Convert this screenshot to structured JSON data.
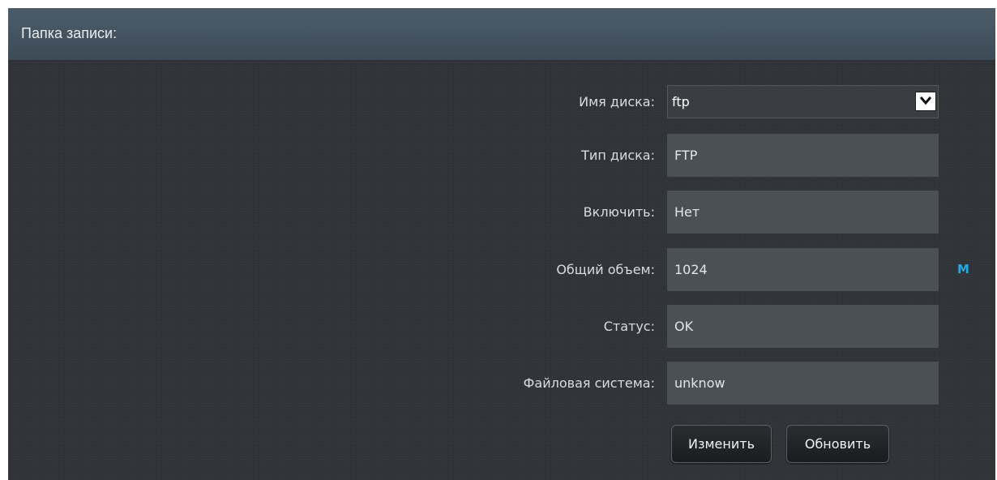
{
  "header": {
    "title": "Папка записи:"
  },
  "form": {
    "disk_name": {
      "label": "Имя диска:",
      "value": "ftp"
    },
    "disk_type": {
      "label": "Тип диска:",
      "value": "FTP"
    },
    "enable": {
      "label": "Включить:",
      "value": "Нет"
    },
    "total_volume": {
      "label": "Общий объем:",
      "value": "1024",
      "unit": "M"
    },
    "status": {
      "label": "Статус:",
      "value": "OK"
    },
    "filesystem": {
      "label": "Файловая система:",
      "value": "unknow"
    }
  },
  "buttons": {
    "change": "Изменить",
    "refresh": "Обновить"
  },
  "icons": {
    "dropdown": "chevron-down-icon"
  },
  "colors": {
    "accent": "#27a9e1",
    "header_bg": "#44535f",
    "field_bg": "#4b5055"
  }
}
